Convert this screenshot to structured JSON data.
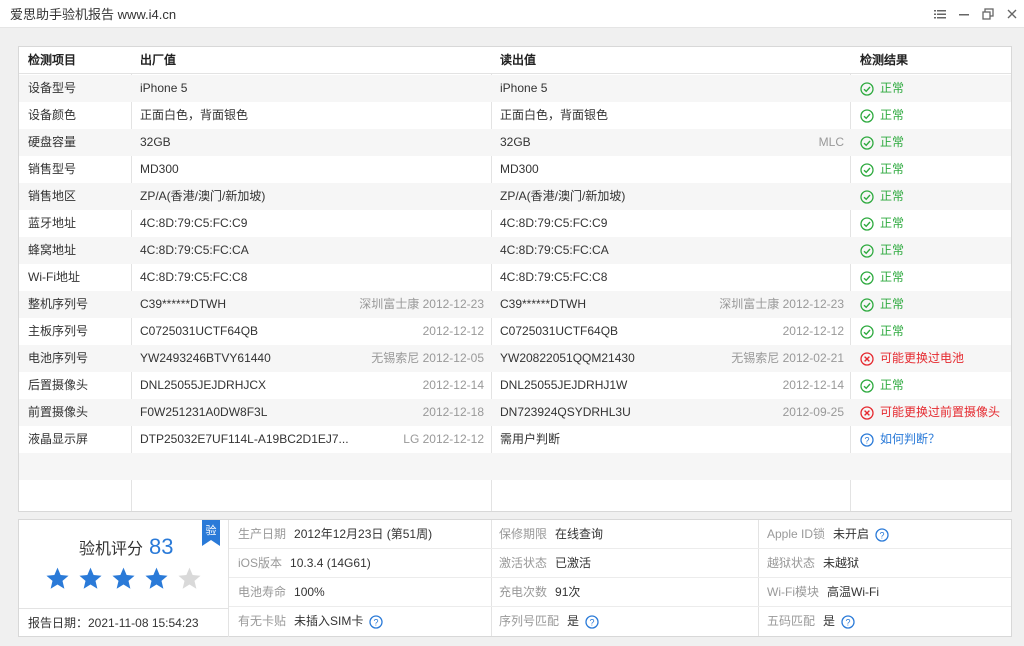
{
  "window": {
    "title": "爱思助手验机报告 www.i4.cn"
  },
  "table": {
    "headers": [
      "检测项目",
      "出厂值",
      "读出值",
      "检测结果"
    ],
    "rows": [
      {
        "item": "设备型号",
        "factory": "iPhone 5",
        "factory_note": "",
        "read": "iPhone 5",
        "read_note": "",
        "result": "正常",
        "status": "ok"
      },
      {
        "item": "设备颜色",
        "factory": "正面白色，背面银色",
        "factory_note": "",
        "read": "正面白色，背面银色",
        "read_note": "",
        "result": "正常",
        "status": "ok"
      },
      {
        "item": "硬盘容量",
        "factory": "32GB",
        "factory_note": "",
        "read": "32GB",
        "read_note": "MLC",
        "result": "正常",
        "status": "ok"
      },
      {
        "item": "销售型号",
        "factory": "MD300",
        "factory_note": "",
        "read": "MD300",
        "read_note": "",
        "result": "正常",
        "status": "ok"
      },
      {
        "item": "销售地区",
        "factory": "ZP/A(香港/澳门/新加坡)",
        "factory_note": "",
        "read": "ZP/A(香港/澳门/新加坡)",
        "read_note": "",
        "result": "正常",
        "status": "ok"
      },
      {
        "item": "蓝牙地址",
        "factory": "4C:8D:79:C5:FC:C9",
        "factory_note": "",
        "read": "4C:8D:79:C5:FC:C9",
        "read_note": "",
        "result": "正常",
        "status": "ok"
      },
      {
        "item": "蜂窝地址",
        "factory": "4C:8D:79:C5:FC:CA",
        "factory_note": "",
        "read": "4C:8D:79:C5:FC:CA",
        "read_note": "",
        "result": "正常",
        "status": "ok"
      },
      {
        "item": "Wi-Fi地址",
        "factory": "4C:8D:79:C5:FC:C8",
        "factory_note": "",
        "read": "4C:8D:79:C5:FC:C8",
        "read_note": "",
        "result": "正常",
        "status": "ok"
      },
      {
        "item": "整机序列号",
        "factory": "C39******DTWH",
        "factory_note": "深圳富士康 2012-12-23",
        "read": "C39******DTWH",
        "read_note": "深圳富士康 2012-12-23",
        "result": "正常",
        "status": "ok"
      },
      {
        "item": "主板序列号",
        "factory": "C0725031UCTF64QB",
        "factory_note": "2012-12-12",
        "read": "C0725031UCTF64QB",
        "read_note": "2012-12-12",
        "result": "正常",
        "status": "ok"
      },
      {
        "item": "电池序列号",
        "factory": "YW2493246BTVY61440",
        "factory_note": "无锡索尼 2012-12-05",
        "read": "YW20822051QQM21430",
        "read_note": "无锡索尼 2012-02-21",
        "result": "可能更换过电池",
        "status": "bad"
      },
      {
        "item": "后置摄像头",
        "factory": "DNL25055JEJDRHJCX",
        "factory_note": "2012-12-14",
        "read": "DNL25055JEJDRHJ1W",
        "read_note": "2012-12-14",
        "result": "正常",
        "status": "ok"
      },
      {
        "item": "前置摄像头",
        "factory": "F0W251231A0DW8F3L",
        "factory_note": "2012-12-18",
        "read": "DN723924QSYDRHL3U",
        "read_note": "2012-09-25",
        "result": "可能更换过前置摄像头",
        "status": "bad"
      },
      {
        "item": "液晶显示屏",
        "factory": "DTP25032E7UF114L-A19BC2D1EJ7...",
        "factory_note": "LG 2012-12-12",
        "read": "需用户判断",
        "read_note": "",
        "result": "如何判断？",
        "status": "info"
      }
    ]
  },
  "summary": {
    "score_label": "验机评分",
    "score": "83",
    "stars_filled": 4,
    "stars_total": 5,
    "badge": "验",
    "report_date": "报告日期：2021-11-08 15:54:23",
    "cells": [
      [
        {
          "label": "生产日期",
          "value": "2012年12月23日 (第51周)"
        },
        {
          "label": "保修期限",
          "value": "在线查询",
          "style": "link"
        },
        {
          "label": "Apple ID锁",
          "value": "未开启",
          "help": true
        }
      ],
      [
        {
          "label": "iOS版本",
          "value": "10.3.4 (14G61)"
        },
        {
          "label": "激活状态",
          "value": "已激活"
        },
        {
          "label": "越狱状态",
          "value": "未越狱"
        }
      ],
      [
        {
          "label": "电池寿命",
          "value": "100%"
        },
        {
          "label": "充电次数",
          "value": "91次"
        },
        {
          "label": "Wi-Fi模块",
          "value": "高温Wi-Fi"
        }
      ],
      [
        {
          "label": "有无卡贴",
          "value": "未插入SIM卡",
          "help": true
        },
        {
          "label": "序列号匹配",
          "value": "是",
          "style": "green",
          "help": true
        },
        {
          "label": "五码匹配",
          "value": "是",
          "style": "green",
          "help": true
        }
      ]
    ]
  },
  "colors": {
    "ok": "#2eaa3f",
    "bad": "#e5292f",
    "info": "#2a7ad8",
    "star_on": "#2a7ad8",
    "star_off": "#d9d9d9"
  }
}
